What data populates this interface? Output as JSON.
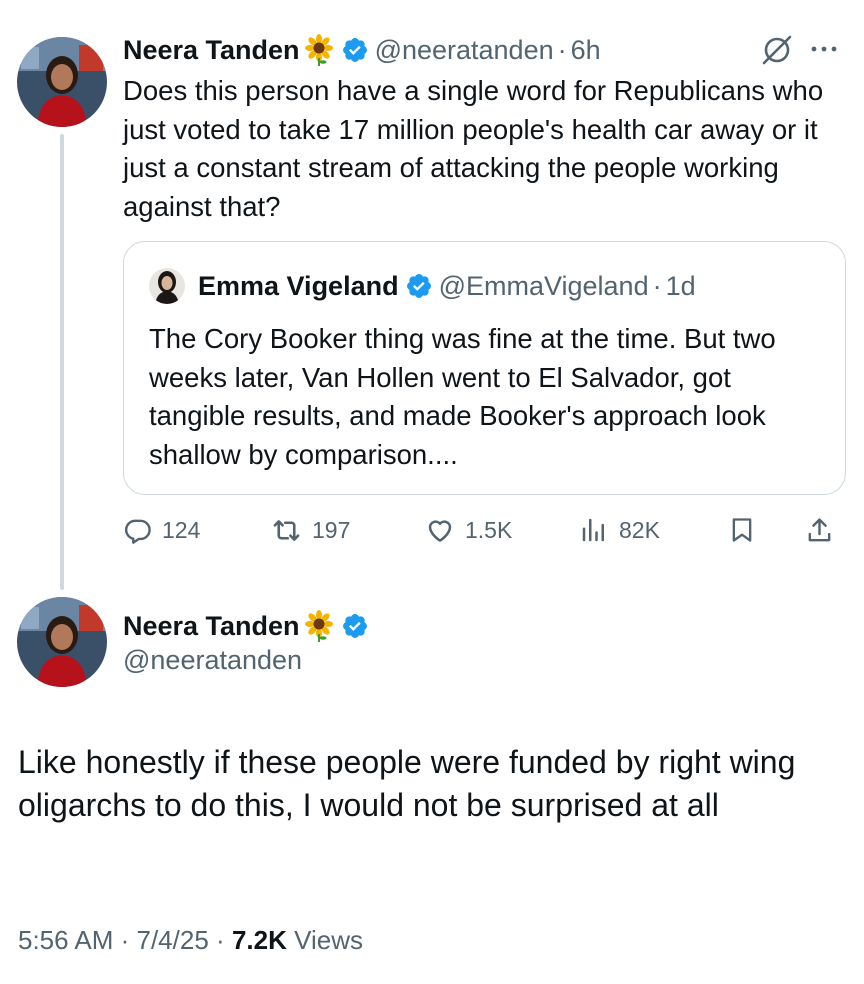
{
  "colors": {
    "text": "#0f1419",
    "secondary": "#536471",
    "verified": "#1d9bf0",
    "border": "#cfd9de"
  },
  "reply_tweet": {
    "author_name": "Neera Tanden",
    "emoji": "sunflower",
    "handle": "@neeratanden",
    "separator": "·",
    "time": "6h",
    "text": "Does this person have a single word for Republicans who just voted to take 17 million people's health car away or it just a constant stream of attacking the people working against that?",
    "quote": {
      "author_name": "Emma Vigeland",
      "handle": "@EmmaVigeland",
      "separator": "·",
      "time": "1d",
      "text": "The Cory Booker thing was fine at the time. But two weeks later, Van Hollen went to El Salvador, got tangible results, and made Booker's approach look shallow by comparison...."
    },
    "actions": {
      "replies": "124",
      "reposts": "197",
      "likes": "1.5K",
      "views": "82K"
    }
  },
  "main_tweet": {
    "author_name": "Neera Tanden",
    "emoji": "sunflower",
    "handle": "@neeratanden",
    "text": "Like honestly if these people were funded by right wing oligarchs to do this,  I would not be surprised at all",
    "timestamp": "5:56 AM · 7/4/25",
    "separator": "·",
    "views_count": "7.2K",
    "views_label": "Views"
  }
}
